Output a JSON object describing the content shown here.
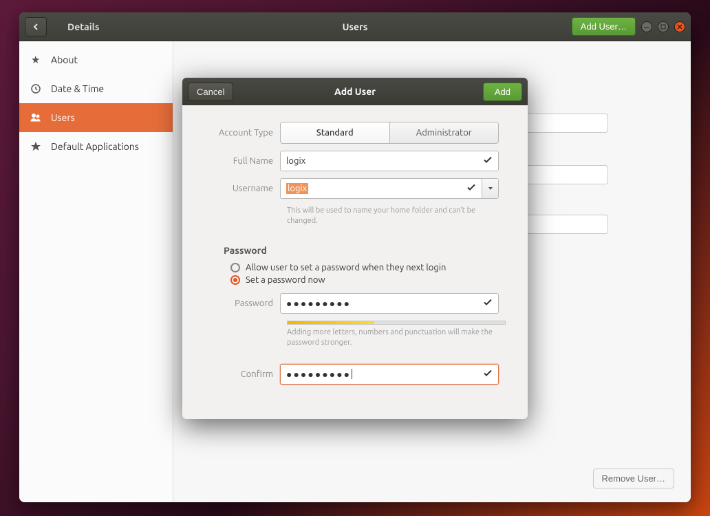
{
  "window": {
    "section": "Details",
    "title": "Users",
    "add_user_btn": "Add User…",
    "remove_user_btn": "Remove User…"
  },
  "sidebar": {
    "items": [
      {
        "label": "About"
      },
      {
        "label": "Date & Time"
      },
      {
        "label": "Users"
      },
      {
        "label": "Default Applications"
      }
    ]
  },
  "dialog": {
    "cancel": "Cancel",
    "title": "Add User",
    "add": "Add",
    "account_type_label": "Account Type",
    "account_type_standard": "Standard",
    "account_type_admin": "Administrator",
    "full_name_label": "Full Name",
    "full_name_value": "logix",
    "username_label": "Username",
    "username_value": "logix",
    "username_hint": "This will be used to name your home folder and can't be changed.",
    "password_header": "Password",
    "radio_later": "Allow user to set a password when they next login",
    "radio_now": "Set a password now",
    "password_label": "Password",
    "password_value": "●●●●●●●●●",
    "strength_hint": "Adding more letters, numbers and punctuation will make the password stronger.",
    "confirm_label": "Confirm",
    "confirm_value": "●●●●●●●●●"
  }
}
